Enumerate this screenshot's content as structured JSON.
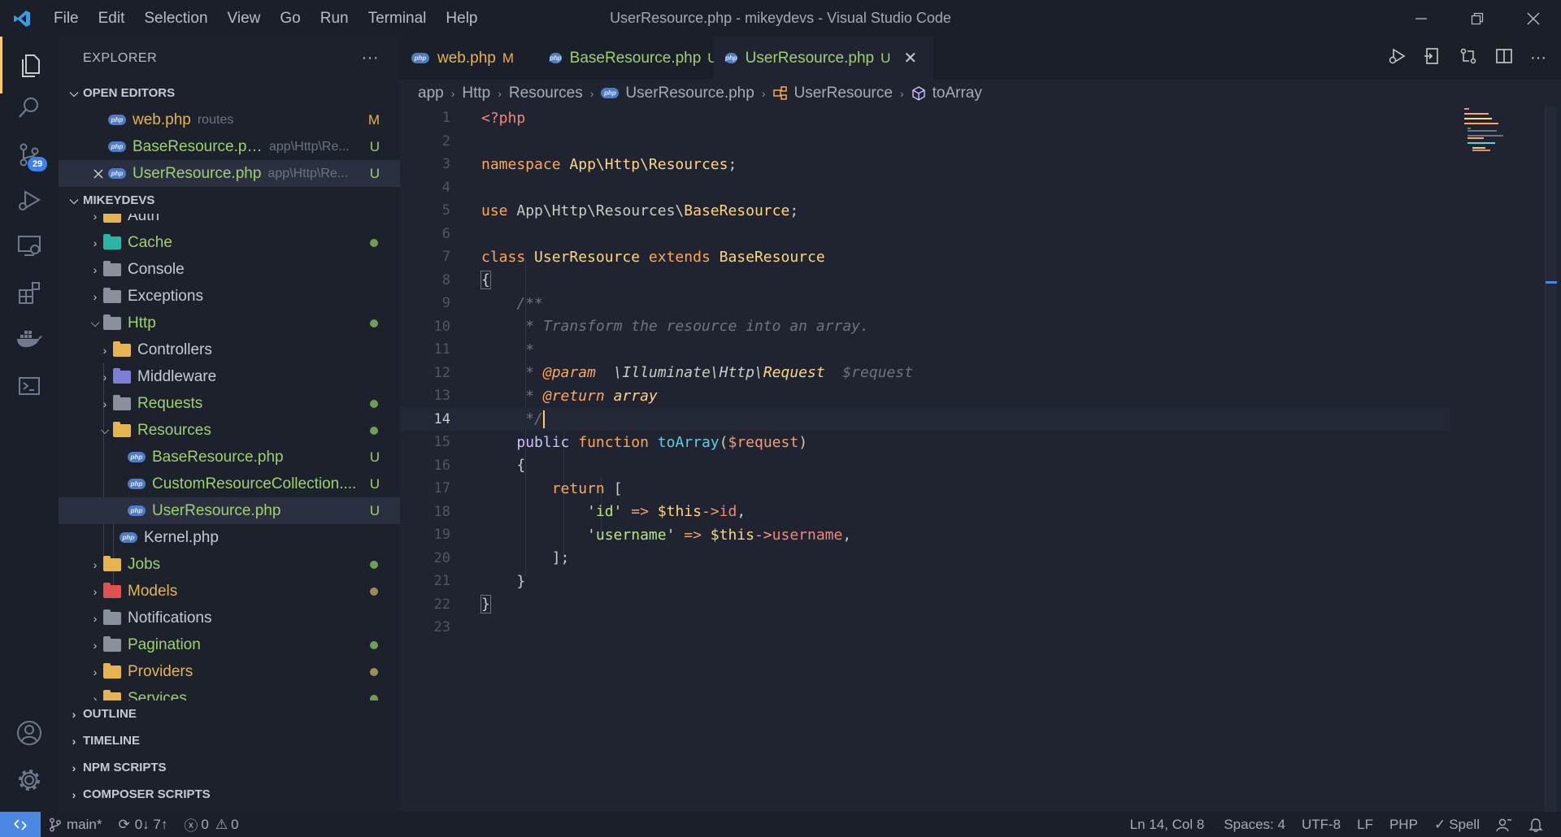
{
  "window": {
    "title": "UserResource.php - mikeydevs - Visual Studio Code"
  },
  "menu": [
    "File",
    "Edit",
    "Selection",
    "View",
    "Go",
    "Run",
    "Terminal",
    "Help"
  ],
  "activity": {
    "scm_badge": "29"
  },
  "sidebar": {
    "header": "EXPLORER",
    "more": "···",
    "open_editors_title": "OPEN EDITORS",
    "open_editors": [
      {
        "name": "web.php",
        "desc": "routes",
        "status": "M"
      },
      {
        "name": "BaseResource.php",
        "desc": "app\\Http\\Re...",
        "status": "U"
      },
      {
        "name": "UserResource.php",
        "desc": "app\\Http\\Re...",
        "status": "U"
      }
    ],
    "workspace_title": "MIKEYDEVS",
    "tree": [
      "Auth",
      "Cache",
      "Console",
      "Exceptions",
      "Http",
      "Controllers",
      "Middleware",
      "Requests",
      "Resources",
      "BaseResource.php",
      "CustomResourceCollection....",
      "UserResource.php",
      "Kernel.php",
      "Jobs",
      "Models",
      "Notifications",
      "Pagination",
      "Providers",
      "Services"
    ],
    "tree_status": {
      "base": "U",
      "custom": "U",
      "user": "U"
    },
    "sections": [
      "OUTLINE",
      "TIMELINE",
      "NPM SCRIPTS",
      "COMPOSER SCRIPTS"
    ]
  },
  "tabs": [
    {
      "label": "web.php",
      "mark": "M"
    },
    {
      "label": "BaseResource.php",
      "mark": "U"
    },
    {
      "label": "UserResource.php",
      "mark": "U"
    }
  ],
  "breadcrumb": [
    "app",
    "Http",
    "Resources",
    "UserResource.php",
    "UserResource",
    "toArray"
  ],
  "editor": {
    "line_numbers": [
      "1",
      "2",
      "3",
      "4",
      "5",
      "6",
      "7",
      "8",
      "9",
      "10",
      "11",
      "12",
      "13",
      "14",
      "15",
      "16",
      "17",
      "18",
      "19",
      "20",
      "21",
      "22",
      "23"
    ],
    "tokens": {
      "php_open": "<?php",
      "namespace_kw": "namespace",
      "namespace_val": "App\\Http\\Resources",
      "semicolon": ";",
      "use_kw": "use",
      "use_path": "App\\Http\\Resources\\",
      "use_cls": "BaseResource",
      "class_kw": "class",
      "class_name": "UserResource",
      "extends_kw": "extends",
      "parent_cls": "BaseResource",
      "open_brace": "{",
      "doc_open": "/**",
      "doc_desc": " * Transform the resource into an array.",
      "doc_star": " *",
      "doc_star_sp": " * ",
      "param_tag": "@param",
      "param_type_ns": "  \\Illuminate\\Http\\",
      "param_type_cls": "Request",
      "param_var": "  $request",
      "return_tag": "@return",
      "return_type": " array",
      "doc_close": " */",
      "public_kw": "public",
      "function_kw": "function",
      "fn_name": "toArray",
      "paren_open": "(",
      "arg": "$request",
      "paren_close": ")",
      "return_kw": "return",
      "bracket_open": "[",
      "key_id": "'id'",
      "arrow": " => ",
      "this": "$this",
      "obj_op": "->",
      "prop_id": "id",
      "comma": ",",
      "key_username": "'username'",
      "prop_username": "username",
      "bracket_close": "];",
      "close_brace": "}"
    }
  },
  "status": {
    "branch": "main*",
    "sync": "0↓ 7↑",
    "errors": "0",
    "warnings": "0",
    "position": "Ln 14, Col 8",
    "spaces": "Spaces: 4",
    "encoding": "UTF-8",
    "eol": "LF",
    "language": "PHP",
    "spell": "Spell"
  },
  "colors": {
    "accent": "#ffcc66",
    "modified": "#e6b450",
    "untracked": "#9ed072",
    "remote": "#4c87e6"
  }
}
